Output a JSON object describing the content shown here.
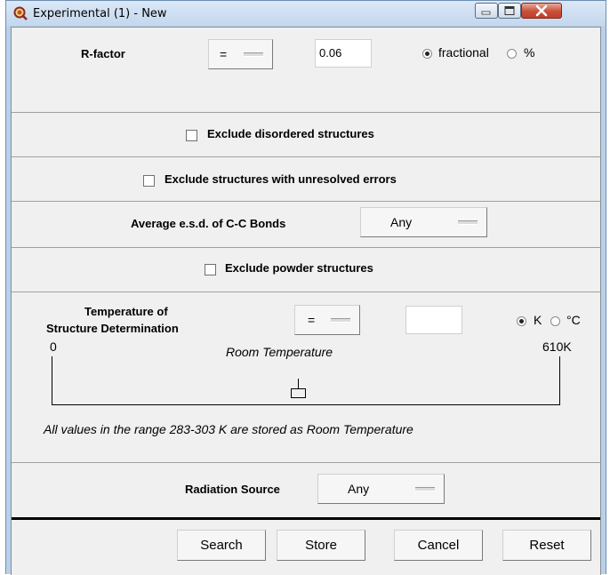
{
  "window": {
    "title": "Experimental (1) - New",
    "app_icon": "search-q-icon",
    "controls": [
      "minimize-icon",
      "maximize-icon",
      "close-icon"
    ]
  },
  "rfactor": {
    "label": "R-factor",
    "operator": "=",
    "value": "0.06",
    "unit_options": [
      "fractional",
      "%"
    ],
    "selected_unit": "fractional"
  },
  "exclude_disordered": {
    "label": "Exclude disordered structures",
    "checked": false
  },
  "exclude_unresolved": {
    "label": "Exclude structures with unresolved errors",
    "checked": false
  },
  "esd": {
    "label": "Average e.s.d. of C-C Bonds",
    "value": "Any"
  },
  "exclude_powder": {
    "label": "Exclude powder structures",
    "checked": false
  },
  "temperature": {
    "label_line1": "Temperature of",
    "label_line2": "Structure Determination",
    "operator": "=",
    "value": "",
    "unit_options": [
      "K",
      "°C"
    ],
    "selected_unit": "K",
    "scale_min": "0",
    "scale_max": "610K",
    "scale_mark_label": "Room Temperature",
    "note": "All values in the range 283-303 K are stored as Room Temperature"
  },
  "radiation": {
    "label": "Radiation Source",
    "value": "Any"
  },
  "buttons": {
    "search": "Search",
    "store": "Store",
    "cancel": "Cancel",
    "reset": "Reset"
  }
}
